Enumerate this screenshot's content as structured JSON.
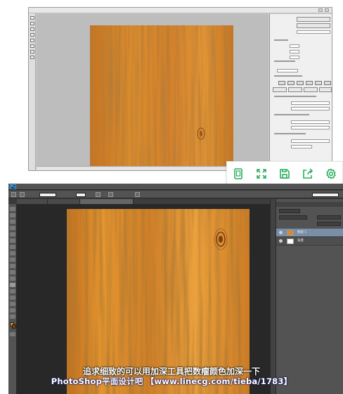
{
  "colors": {
    "wood_base": "#d98a2a",
    "wood_dark": "#a3561a",
    "wood_light": "#eea24a",
    "ps_dark_panel": "#535353",
    "ps_workspace": "#282828",
    "classic_gray": "#c8c8c8",
    "toolbar_icon_green": "#2aae5c",
    "layer_selected": "#7a8ea8"
  },
  "floating_toolbar": {
    "items": [
      {
        "name": "view-original-icon"
      },
      {
        "name": "fullscreen-icon"
      },
      {
        "name": "save-icon"
      },
      {
        "name": "share-icon"
      },
      {
        "name": "settings-icon"
      }
    ]
  },
  "ps_window": {
    "logo": "Ps"
  },
  "layers": [
    {
      "name": "图层 1",
      "selected": true
    },
    {
      "name": "背景",
      "selected": false
    }
  ],
  "caption": {
    "line1": "追求细致的可以用加深工具把数瘤颜色加深一下",
    "line2": "PhotoShop平面设计吧 【www.linecg.com/tieba/1783】"
  }
}
